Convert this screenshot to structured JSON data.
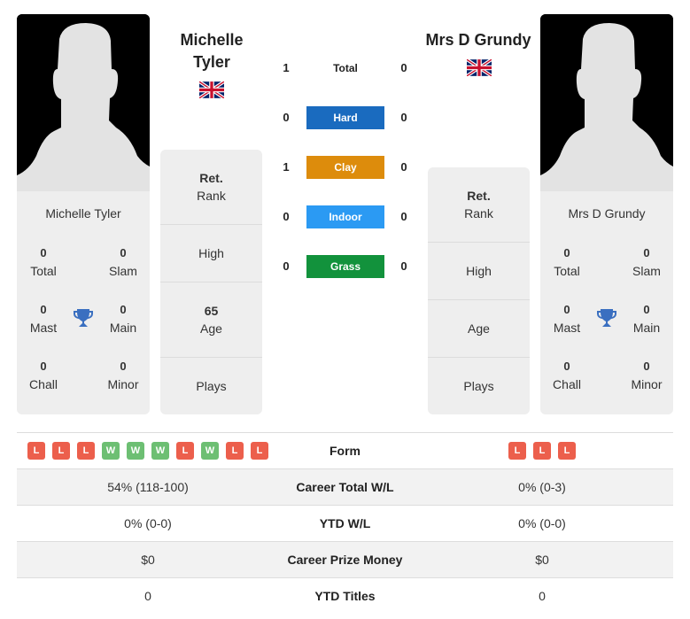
{
  "player_left": {
    "name": "Michelle Tyler",
    "name_line1": "Michelle",
    "name_line2": "Tyler",
    "flag": "gb-flag",
    "titles": {
      "total": {
        "value": "0",
        "label": "Total"
      },
      "slam": {
        "value": "0",
        "label": "Slam"
      },
      "mast": {
        "value": "0",
        "label": "Mast"
      },
      "main": {
        "value": "0",
        "label": "Main"
      },
      "chall": {
        "value": "0",
        "label": "Chall"
      },
      "minor": {
        "value": "0",
        "label": "Minor"
      }
    },
    "info": {
      "rank_value": "Ret.",
      "rank_label": "Rank",
      "high_label": "High",
      "age_value": "65",
      "age_label": "Age",
      "plays_label": "Plays"
    }
  },
  "player_right": {
    "name": "Mrs D Grundy",
    "flag": "gb-flag",
    "titles": {
      "total": {
        "value": "0",
        "label": "Total"
      },
      "slam": {
        "value": "0",
        "label": "Slam"
      },
      "mast": {
        "value": "0",
        "label": "Mast"
      },
      "main": {
        "value": "0",
        "label": "Main"
      },
      "chall": {
        "value": "0",
        "label": "Chall"
      },
      "minor": {
        "value": "0",
        "label": "Minor"
      }
    },
    "info": {
      "rank_value": "Ret.",
      "rank_label": "Rank",
      "high_label": "High",
      "age_label": "Age",
      "plays_label": "Plays"
    }
  },
  "h2h": [
    {
      "label": "Total",
      "left": "1",
      "right": "0",
      "color": ""
    },
    {
      "label": "Hard",
      "left": "0",
      "right": "0",
      "color": "#1a6bbf"
    },
    {
      "label": "Clay",
      "left": "1",
      "right": "0",
      "color": "#dd8c0c"
    },
    {
      "label": "Indoor",
      "left": "0",
      "right": "0",
      "color": "#2b9af3"
    },
    {
      "label": "Grass",
      "left": "0",
      "right": "0",
      "color": "#12923c"
    }
  ],
  "comparison": {
    "form_label": "Form",
    "form_left": [
      "L",
      "L",
      "L",
      "W",
      "W",
      "W",
      "L",
      "W",
      "L",
      "L"
    ],
    "form_right": [
      "L",
      "L",
      "L"
    ],
    "rows": [
      {
        "label": "Career Total W/L",
        "left": "54% (118-100)",
        "right": "0% (0-3)"
      },
      {
        "label": "YTD W/L",
        "left": "0% (0-0)",
        "right": "0% (0-0)"
      },
      {
        "label": "Career Prize Money",
        "left": "$0",
        "right": "$0"
      },
      {
        "label": "YTD Titles",
        "left": "0",
        "right": "0"
      }
    ]
  },
  "colors": {
    "loss": "#ec5f4c",
    "win": "#6dbf73",
    "trophy": "#3a6fc0"
  }
}
